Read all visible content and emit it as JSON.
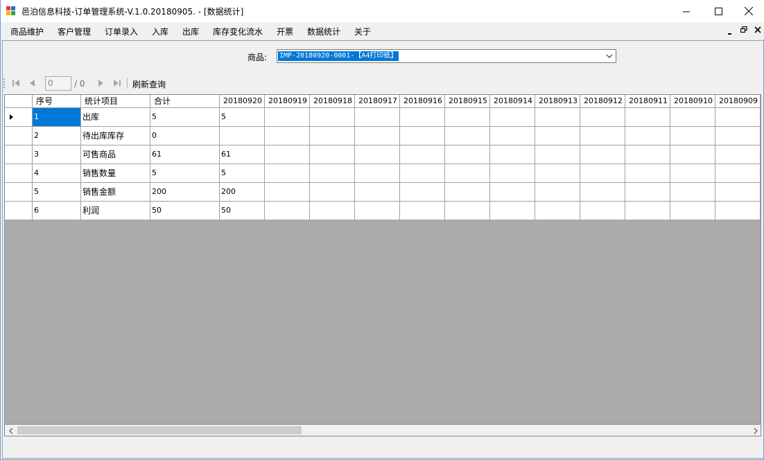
{
  "window": {
    "title": "邑泊信息科技-订单管理系统-V.1.0.20180905. - [数据统计]"
  },
  "menu": {
    "items": [
      "商品维护",
      "客户管理",
      "订单录入",
      "入库",
      "出库",
      "库存变化流水",
      "开票",
      "数据统计",
      "关于"
    ]
  },
  "filter": {
    "label": "商品:",
    "value": "IMP-20180920-0001-【A4打印纸】"
  },
  "navigator": {
    "page": "0",
    "total": "/ 0",
    "refresh": "刷新查询"
  },
  "grid": {
    "columns": [
      "序号",
      "统计项目",
      "合计",
      "20180920",
      "20180919",
      "20180918",
      "20180917",
      "20180916",
      "20180915",
      "20180914",
      "20180913",
      "20180912",
      "20180911",
      "20180910",
      "20180909"
    ],
    "rows": [
      [
        "1",
        "出库",
        "5",
        "5"
      ],
      [
        "2",
        "待出库库存",
        "0",
        ""
      ],
      [
        "3",
        "可售商品",
        "61",
        "61"
      ],
      [
        "4",
        "销售数量",
        "5",
        "5"
      ],
      [
        "5",
        "销售金额",
        "200",
        "200"
      ],
      [
        "6",
        "利润",
        "50",
        "50"
      ]
    ]
  },
  "colors": {
    "selection": "#0078d7",
    "grid_background": "#ababab"
  }
}
